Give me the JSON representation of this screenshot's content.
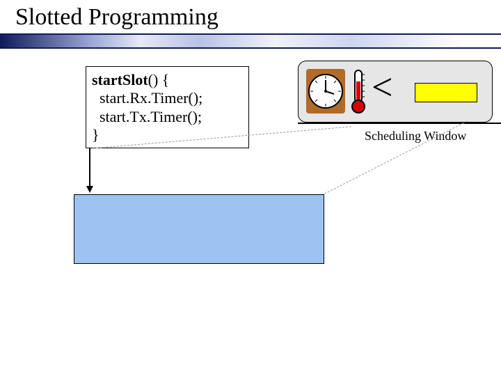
{
  "title": "Slotted Programming",
  "code": {
    "line1_bold": "startSlot",
    "line1_rest": "() {",
    "line2": "  start.Rx.Timer();",
    "line3": "  start.Tx.Timer();",
    "line4": "}"
  },
  "comparator": "<",
  "labels": {
    "scheduling": "Scheduling Window"
  },
  "chart_data": {
    "type": "table",
    "title": "Slotted Programming diagram elements",
    "items": [
      {
        "element": "code box",
        "content": "startSlot(){start.Rx.Timer();start.Tx.Timer();}"
      },
      {
        "element": "scheduling window",
        "contains": [
          "clock",
          "thermometer",
          "<",
          "yellow slot"
        ]
      },
      {
        "element": "blue timeline segment",
        "below": "code box"
      }
    ]
  }
}
